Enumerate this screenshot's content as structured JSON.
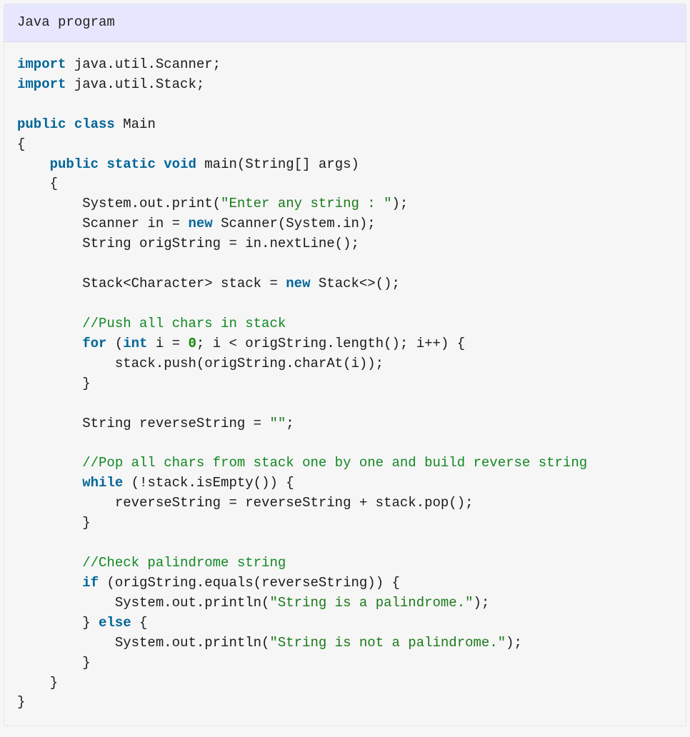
{
  "header": {
    "title": "Java program"
  },
  "code": {
    "kw_import1": "import",
    "import1_rest": " java.util.Scanner;",
    "kw_import2": "import",
    "import2_rest": " java.util.Stack;",
    "kw_public1": "public",
    "kw_class": "class",
    "class_name": " Main",
    "brace_open1": "{",
    "indent1": "    ",
    "kw_public2": "public",
    "kw_static": "static",
    "kw_void": "void",
    "main_sig": " main(String[] args)",
    "brace_open2": "    {",
    "line_print": "        System.out.print(",
    "str_enter": "\"Enter any string : \"",
    "line_print_end": ");",
    "line_scanner_a": "        Scanner in = ",
    "kw_new1": "new",
    "line_scanner_b": " Scanner(System.in);",
    "line_orig": "        String origString = in.nextLine();",
    "line_stack_a": "        Stack<Character> stack = ",
    "kw_new2": "new",
    "line_stack_b": " Stack<>();",
    "com_push": "        //Push all chars in stack",
    "for_a": "        ",
    "kw_for": "for",
    "for_b": " (",
    "kw_int": "int",
    "for_c": " i = ",
    "num_zero": "0",
    "for_d": "; i < origString.length(); i++) {",
    "line_push": "            stack.push(origString.charAt(i));",
    "brace_close_for": "        }",
    "line_rev_decl_a": "        String reverseString = ",
    "str_empty": "\"\"",
    "line_rev_decl_b": ";",
    "com_pop": "        //Pop all chars from stack one by one and build reverse string",
    "while_a": "        ",
    "kw_while": "while",
    "while_b": " (!stack.isEmpty()) {",
    "line_concat": "            reverseString = reverseString + stack.pop();",
    "brace_close_while": "        }",
    "com_check": "        //Check palindrome string",
    "if_a": "        ",
    "kw_if": "if",
    "if_b": " (origString.equals(reverseString)) {",
    "line_println1_a": "            System.out.println(",
    "str_pal": "\"String is a palindrome.\"",
    "line_println1_b": ");",
    "else_a": "        } ",
    "kw_else": "else",
    "else_b": " {",
    "line_println2_a": "            System.out.println(",
    "str_notpal": "\"String is not a palindrome.\"",
    "line_println2_b": ");",
    "brace_close_if": "        }",
    "brace_close_main": "    }",
    "brace_close_class": "}"
  }
}
